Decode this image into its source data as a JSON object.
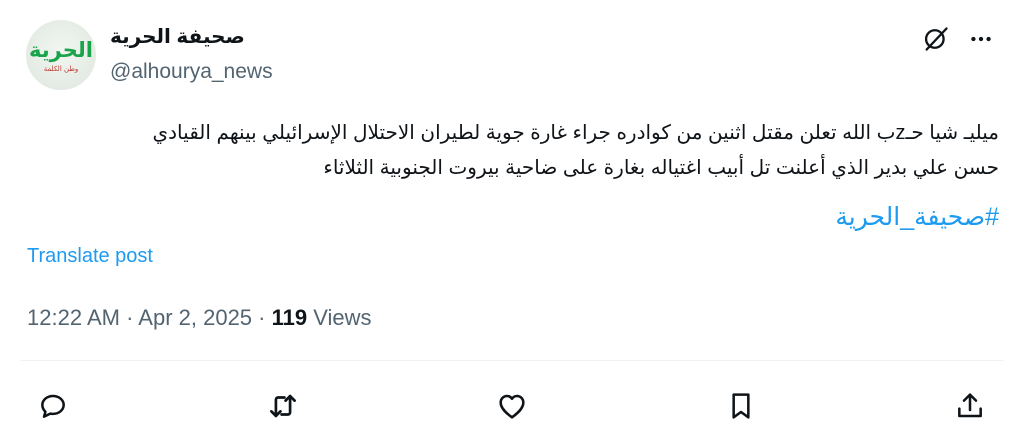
{
  "author": {
    "display_name": "صحيفة الحرية",
    "handle": "@alhourya_news",
    "avatar": {
      "logo_main": "الحرية",
      "logo_sub": "وطن الكلمة"
    }
  },
  "post": {
    "lines": [
      "ميليـ شيا حـzب الله تعلن مقتل اثنين من كوادره جراء غارة جوية لطيران الاحتلال الإسرائيلي بينهم القيادي",
      "حسن علي بدير الذي أعلنت تل أبيب اغتياله بغارة على ضاحية بيروت الجنوبية الثلاثاء"
    ],
    "hashtag": "#صحيفة_الحرية",
    "translate_label": "Translate post"
  },
  "meta": {
    "time": "12:22 AM",
    "sep1": " · ",
    "date": "Apr 2, 2025",
    "sep2": " · ",
    "views_count": "119",
    "views_label": " Views"
  },
  "icons": {
    "top": [
      "grok-icon",
      "more-icon"
    ],
    "actions": [
      "reply-icon",
      "repost-icon",
      "like-icon",
      "bookmark-icon",
      "share-icon"
    ]
  },
  "colors": {
    "link": "#1d9bf0",
    "secondary_text": "#536471",
    "primary_text": "#0f1419",
    "logo_green": "#19a34a"
  }
}
